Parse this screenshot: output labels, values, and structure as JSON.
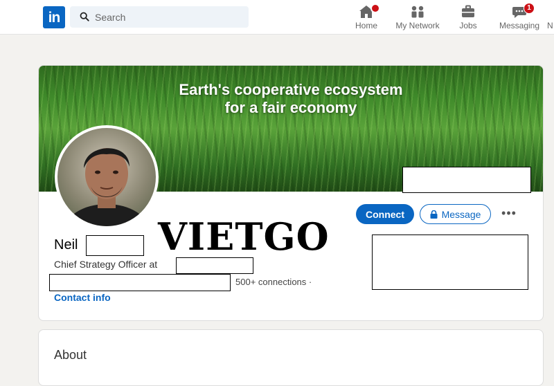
{
  "nav": {
    "logo": "in",
    "search_placeholder": "Search",
    "items": [
      {
        "label": "Home",
        "icon": "home-icon",
        "badge": ""
      },
      {
        "label": "My Network",
        "icon": "network-icon",
        "badge": ""
      },
      {
        "label": "Jobs",
        "icon": "briefcase-icon",
        "badge": ""
      },
      {
        "label": "Messaging",
        "icon": "chat-icon",
        "badge": "1"
      },
      {
        "label": "N",
        "icon": "",
        "badge": ""
      }
    ]
  },
  "profile": {
    "banner_line1": "Earth's cooperative ecosystem",
    "banner_line2": "for a fair economy",
    "name": "Neil",
    "headline": "Chief Strategy Officer at",
    "connections": "500+ connections ·",
    "contact_info": "Contact info",
    "connect_label": "Connect",
    "message_label": "Message",
    "more_label": "•••",
    "watermark": "VIETGO"
  },
  "about": {
    "title": "About"
  },
  "colors": {
    "brand": "#0a66c2",
    "badge": "#cc1016",
    "background": "#f3f2ef"
  }
}
